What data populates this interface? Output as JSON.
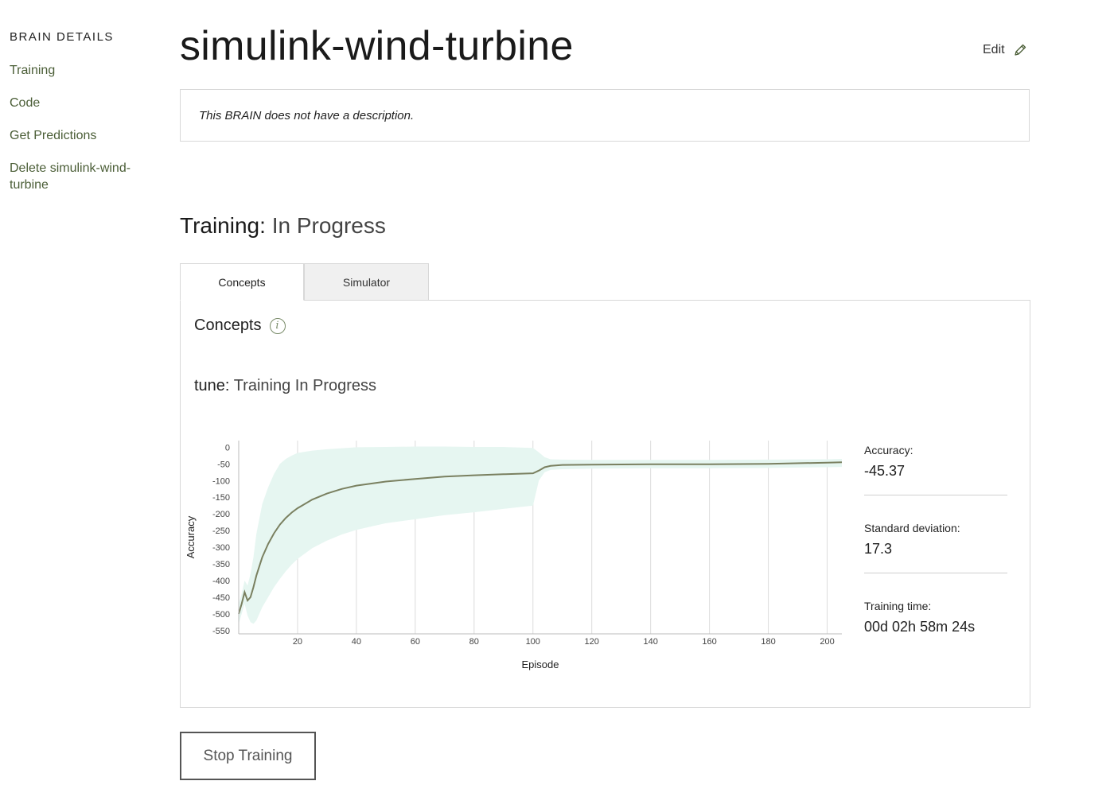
{
  "sidebar": {
    "heading": "BRAIN DETAILS",
    "items": [
      {
        "label": "Training"
      },
      {
        "label": "Code"
      },
      {
        "label": "Get Predictions"
      },
      {
        "label": "Delete simulink-wind-turbine"
      }
    ]
  },
  "header": {
    "title": "simulink-wind-turbine",
    "edit_label": "Edit",
    "edit_icon": "pencil-icon"
  },
  "description": "This BRAIN does not have a description.",
  "training": {
    "label": "Training:",
    "status": "In Progress"
  },
  "tabs": [
    {
      "label": "Concepts",
      "active": true
    },
    {
      "label": "Simulator",
      "active": false
    }
  ],
  "concepts": {
    "title": "Concepts",
    "info_icon": "info-icon",
    "concept_name": "tune:",
    "concept_status": "Training In Progress"
  },
  "chart_data": {
    "type": "line",
    "xlabel": "Episode",
    "ylabel": "Accuracy",
    "xlim": [
      0,
      205
    ],
    "ylim": [
      -560,
      20
    ],
    "x_ticks": [
      20,
      40,
      60,
      80,
      100,
      120,
      140,
      160,
      180,
      200
    ],
    "y_ticks": [
      0,
      -50,
      -100,
      -150,
      -200,
      -250,
      -300,
      -350,
      -400,
      -450,
      -500,
      -550
    ],
    "grid": "vertical",
    "line_color": "#7a8060",
    "band_color": "#e6f6f1",
    "series": [
      {
        "x": [
          0,
          1,
          2,
          3,
          4,
          5,
          6,
          8,
          10,
          12,
          14,
          16,
          18,
          20,
          25,
          30,
          35,
          40,
          50,
          60,
          70,
          80,
          90,
          100,
          102,
          104,
          106,
          110,
          120,
          140,
          160,
          180,
          200,
          205
        ],
        "values": [
          -500,
          -470,
          -435,
          -460,
          -450,
          -420,
          -385,
          -330,
          -290,
          -258,
          -232,
          -212,
          -196,
          -183,
          -157,
          -139,
          -125,
          -115,
          -103,
          -95,
          -88,
          -84,
          -81,
          -78,
          -70,
          -60,
          -56,
          -53,
          -52,
          -51,
          -51,
          -50,
          -46,
          -45
        ],
        "lower": [
          -530,
          -500,
          -470,
          -505,
          -525,
          -530,
          -520,
          -480,
          -450,
          -420,
          -395,
          -372,
          -352,
          -335,
          -303,
          -280,
          -262,
          -248,
          -228,
          -216,
          -204,
          -195,
          -185,
          -175,
          -100,
          -75,
          -68,
          -66,
          -64,
          -63,
          -63,
          -62,
          -60,
          -59
        ],
        "upper": [
          -470,
          -440,
          -400,
          -415,
          -380,
          -330,
          -260,
          -170,
          -120,
          -80,
          -50,
          -35,
          -25,
          -17,
          -10,
          -6,
          -3,
          0,
          1,
          2,
          2,
          1,
          1,
          -2,
          -15,
          -30,
          -36,
          -37,
          -38,
          -38,
          -38,
          -37,
          -36,
          -35
        ]
      }
    ]
  },
  "stats": [
    {
      "label": "Accuracy:",
      "value": "-45.37"
    },
    {
      "label": "Standard deviation:",
      "value": "17.3"
    },
    {
      "label": "Training time:",
      "value": "00d 02h 58m 24s"
    }
  ],
  "stop_button_label": "Stop Training"
}
